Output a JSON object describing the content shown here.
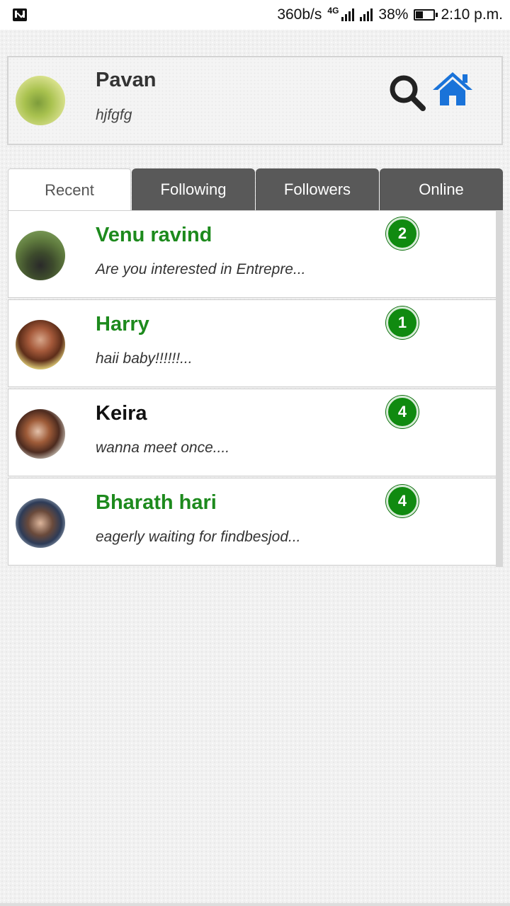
{
  "status_bar": {
    "net_speed": "360b/s",
    "net_type": "4G",
    "battery_percent": "38%",
    "battery_level": 0.38,
    "time": "2:10 p.m.",
    "icons": [
      "gmail-icon",
      "signal-icon",
      "signal-icon",
      "battery-icon"
    ]
  },
  "profile": {
    "name": "Pavan",
    "status": "hjfgfg",
    "search_icon": "search-icon",
    "home_icon": "home-icon",
    "colors": {
      "search": "#222222",
      "home": "#1a73d9"
    }
  },
  "tabs": [
    {
      "label": "Recent",
      "active": true
    },
    {
      "label": "Following",
      "active": false
    },
    {
      "label": "Followers",
      "active": false
    },
    {
      "label": "Online",
      "active": false
    }
  ],
  "conversations": [
    {
      "name": "Venu ravind",
      "message": "Are you interested in Entrepre...",
      "unread": "2",
      "name_color": "#1d8a1d"
    },
    {
      "name": "Harry",
      "message": "haii baby!!!!!!...",
      "unread": "1",
      "name_color": "#1d8a1d"
    },
    {
      "name": "Keira",
      "message": "wanna meet once....",
      "unread": "4",
      "name_color": "#111111"
    },
    {
      "name": "Bharath hari",
      "message": "eagerly waiting for findbesjod...",
      "unread": "4",
      "name_color": "#1d8a1d"
    }
  ],
  "colors": {
    "accent_green": "#108a10",
    "tab_inactive": "#595959",
    "tab_active": "#ffffff"
  }
}
